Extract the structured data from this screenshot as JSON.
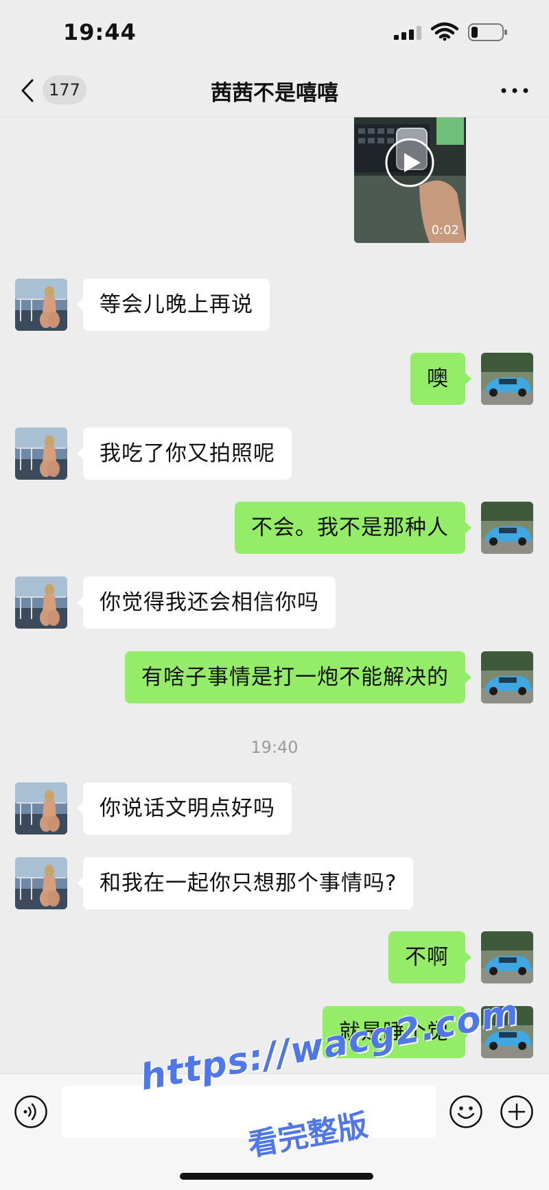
{
  "status_bar": {
    "time": "19:44"
  },
  "header": {
    "unread_count": "177",
    "title": "茜茜不是嘻嘻"
  },
  "video": {
    "duration": "0:02"
  },
  "messages": [
    {
      "side": "left",
      "text": "等会儿晚上再说"
    },
    {
      "side": "right",
      "text": "噢"
    },
    {
      "side": "left",
      "text": "我吃了你又拍照呢"
    },
    {
      "side": "right",
      "text": "不会。我不是那种人"
    },
    {
      "side": "left",
      "text": "你觉得我还会相信你吗"
    },
    {
      "side": "right",
      "text": "有啥子事情是打一炮不能解决的"
    },
    {
      "side": "left",
      "text": "你说话文明点好吗"
    },
    {
      "side": "left",
      "text": "和我在一起你只想那个事情吗?"
    },
    {
      "side": "right",
      "text": "不啊"
    },
    {
      "side": "right",
      "text": "就是睡个觉"
    }
  ],
  "timestamp": "19:40",
  "input": {
    "value": ""
  },
  "watermark": {
    "url": "https://wacg2.com",
    "subtitle": "看完整版"
  },
  "colors": {
    "background": "#ededed",
    "self_bubble": "#95ec69",
    "other_bubble": "#ffffff",
    "watermark": "#5077e8"
  },
  "icons": {
    "back": "chevron-left-icon",
    "more": "more-dots-icon",
    "play": "play-icon",
    "voice": "voice-icon",
    "emoji": "emoji-icon",
    "plus": "plus-icon"
  }
}
